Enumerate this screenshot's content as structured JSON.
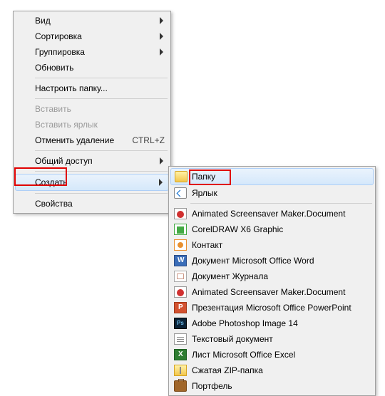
{
  "primary": {
    "view": "Вид",
    "sort": "Сортировка",
    "group": "Группировка",
    "refresh": "Обновить",
    "customize_folder": "Настроить папку...",
    "paste": "Вставить",
    "paste_shortcut": "Вставить ярлык",
    "undo_delete": "Отменить удаление",
    "undo_delete_shortcut": "CTRL+Z",
    "share": "Общий доступ",
    "create": "Создать",
    "properties": "Свойства"
  },
  "submenu": {
    "folder": "Папку",
    "shortcut": "Ярлык",
    "asm_doc": "Animated Screensaver Maker.Document",
    "coreldraw": "CorelDRAW X6 Graphic",
    "contact": "Контакт",
    "word": "Документ Microsoft Office Word",
    "journal": "Документ Журнала",
    "asm_doc2": "Animated Screensaver Maker.Document",
    "powerpoint": "Презентация Microsoft Office PowerPoint",
    "photoshop": "Adobe Photoshop Image 14",
    "text": "Текстовый документ",
    "excel": "Лист Microsoft Office Excel",
    "zip": "Сжатая ZIP-папка",
    "briefcase": "Портфель"
  }
}
